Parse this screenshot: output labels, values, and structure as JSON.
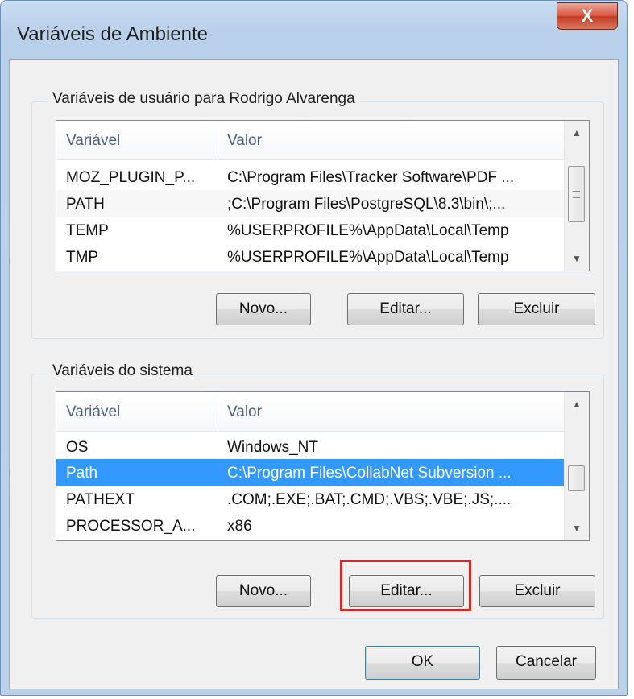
{
  "window": {
    "title": "Variáveis de Ambiente",
    "close_label": "X"
  },
  "user_vars": {
    "group_label": "Variáveis de usuário para Rodrigo Alvarenga",
    "columns": [
      "Variável",
      "Valor"
    ],
    "rows": [
      {
        "name": "MOZ_PLUGIN_P...",
        "value": "C:\\Program Files\\Tracker Software\\PDF ..."
      },
      {
        "name": "PATH",
        "value": ";C:\\Program Files\\PostgreSQL\\8.3\\bin\\;..."
      },
      {
        "name": "TEMP",
        "value": "%USERPROFILE%\\AppData\\Local\\Temp"
      },
      {
        "name": "TMP",
        "value": "%USERPROFILE%\\AppData\\Local\\Temp"
      }
    ],
    "buttons": {
      "new": "Novo...",
      "edit": "Editar...",
      "delete": "Excluir"
    }
  },
  "system_vars": {
    "group_label": "Variáveis do sistema",
    "columns": [
      "Variável",
      "Valor"
    ],
    "rows": [
      {
        "name": "OS",
        "value": "Windows_NT"
      },
      {
        "name": "Path",
        "value": "C:\\Program Files\\CollabNet Subversion ...",
        "selected": true
      },
      {
        "name": "PATHEXT",
        "value": ".COM;.EXE;.BAT;.CMD;.VBS;.VBE;.JS;...."
      },
      {
        "name": "PROCESSOR_A...",
        "value": "x86"
      }
    ],
    "buttons": {
      "new": "Novo...",
      "edit": "Editar...",
      "delete": "Excluir"
    }
  },
  "footer": {
    "ok": "OK",
    "cancel": "Cancelar"
  },
  "colors": {
    "selection": "#3399ff",
    "highlight_box": "#d12a2a"
  },
  "icons": [
    "close-icon",
    "scroll-up-icon",
    "scroll-down-icon"
  ]
}
